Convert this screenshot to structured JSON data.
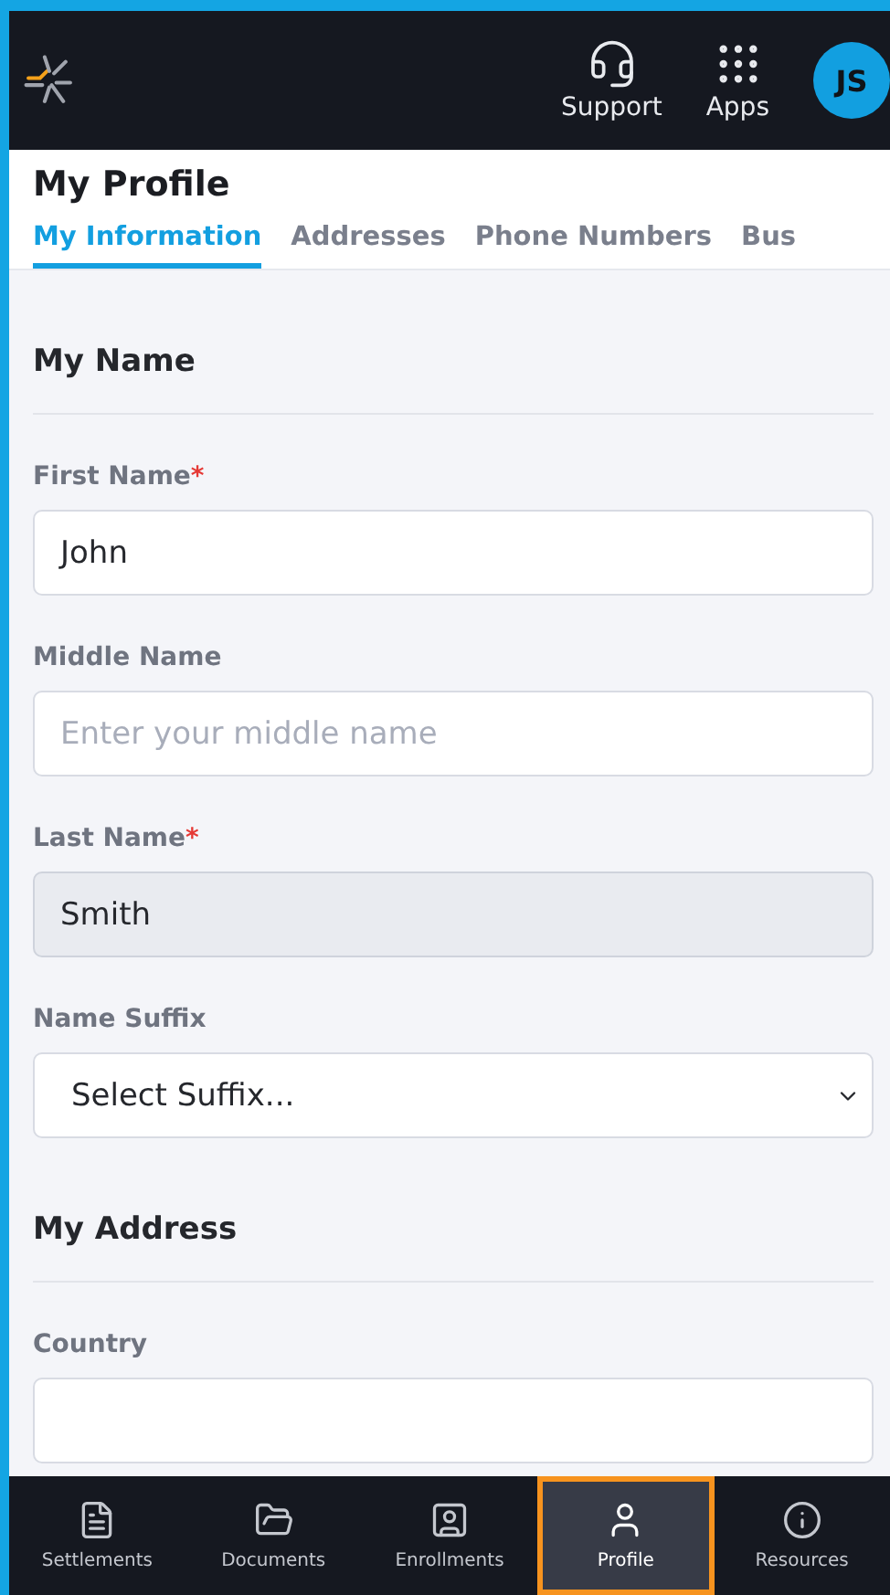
{
  "header": {
    "actions": [
      {
        "kind": "support",
        "label": "Support"
      },
      {
        "kind": "apps",
        "label": "Apps"
      }
    ],
    "avatar": "JS"
  },
  "page": {
    "title": "My Profile"
  },
  "tabs": [
    {
      "label": "My Information",
      "selected": true
    },
    {
      "label": "Addresses",
      "selected": false
    },
    {
      "label": "Phone Numbers",
      "selected": false
    },
    {
      "label": "Bus",
      "selected": false
    }
  ],
  "sections": [
    {
      "title": "My Name",
      "fields": [
        {
          "label": "First Name",
          "required_mark": "*",
          "kind": "text",
          "value": "John",
          "disabled": false
        },
        {
          "label": "Middle Name",
          "kind": "text",
          "placeholder": "Enter your middle name",
          "disabled": false
        },
        {
          "label": "Last Name",
          "required_mark": "*",
          "kind": "text",
          "value": "Smith",
          "disabled": true
        },
        {
          "label": "Name Suffix",
          "kind": "select",
          "value": "Select Suffix..."
        }
      ]
    },
    {
      "title": "My Address",
      "fields": [
        {
          "label": "Country",
          "kind": "text",
          "disabled": false
        }
      ]
    }
  ],
  "bottom_nav": [
    {
      "label": "Settlements",
      "selected": false
    },
    {
      "label": "Documents",
      "selected": false
    },
    {
      "label": "Enrollments",
      "selected": false
    },
    {
      "label": "Profile",
      "selected": true
    },
    {
      "label": "Resources",
      "selected": false
    }
  ]
}
